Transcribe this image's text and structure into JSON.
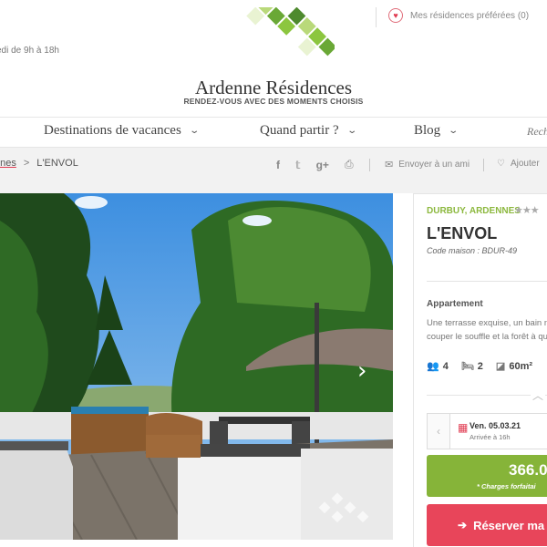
{
  "header": {
    "contact_line": "edi de 9h à 18h",
    "logo_title": "Ardenne Résidences",
    "logo_tagline": "RENDEZ-VOUS AVEC DES MOMENTS CHOISIS",
    "favorites_label": "Mes résidences préférées (0)",
    "favorites_icon": "heart-icon"
  },
  "nav": {
    "items": [
      {
        "label": "Destinations de vacances"
      },
      {
        "label": "Quand partir ?"
      },
      {
        "label": "Blog"
      }
    ],
    "search_label": "Rech"
  },
  "breadcrumb": {
    "parent": "nnes",
    "separator": ">",
    "current": "L'ENVOL"
  },
  "share": {
    "social_icons": [
      "f",
      "t",
      "g+",
      "print"
    ],
    "send_friend": "Envoyer à un ami",
    "add_fav": "Ajouter"
  },
  "listing": {
    "location": "DURBUY, ARDENNES",
    "stars": "★★★",
    "name": "L'ENVOL",
    "code": "Code maison : BDUR-49",
    "type": "Appartement",
    "description_line1": "Une terrasse exquise, un bain n",
    "description_line2": "couper le souffle et la forêt à qu",
    "persons": "4",
    "bedrooms": "2",
    "area": "60m²",
    "date": "Ven. 05.03.21",
    "arrival": "Arrivée à 16h",
    "price": "366.0",
    "charges": "* Charges forfaitai",
    "reserve_label": "Réserver ma"
  },
  "colors": {
    "accent_green": "#86b439",
    "accent_red": "#e8455a",
    "location_green": "#8cb83e"
  }
}
